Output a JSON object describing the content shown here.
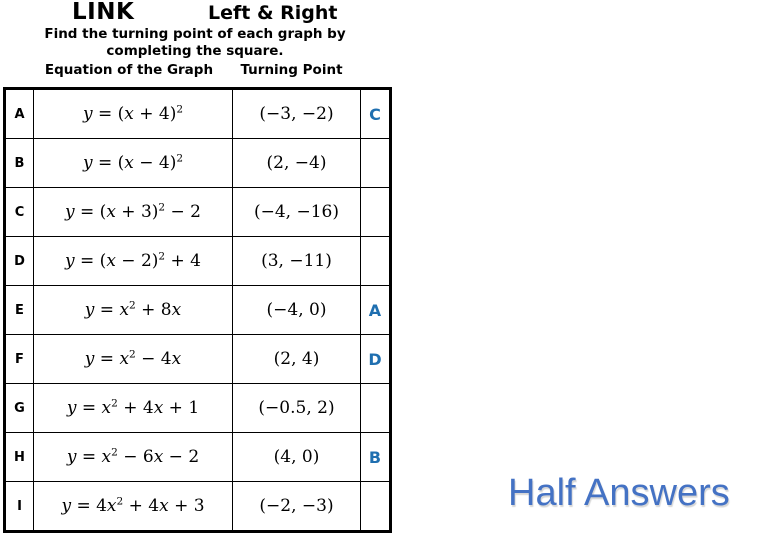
{
  "header": {
    "link_title": "LINK",
    "topic_title": "Left & Right",
    "subtitle": "Find the turning point of each graph by completing the square.",
    "column_headers": {
      "equation": "Equation of the Graph",
      "turning_point": "Turning Point"
    }
  },
  "table": {
    "rows": [
      {
        "label": "A",
        "equation_text": "y = (x + 4)²",
        "equation": {
          "lhs": "y",
          "eq": " = (",
          "var": "x",
          "op": " + 4)",
          "exp": "2",
          "tail": ""
        },
        "turning_point": "(−3, −2)",
        "answer": "C"
      },
      {
        "label": "B",
        "equation_text": "y = (x − 4)²",
        "equation": {
          "lhs": "y",
          "eq": " = (",
          "var": "x",
          "op": " − 4)",
          "exp": "2",
          "tail": ""
        },
        "turning_point": "(2, −4)",
        "answer": ""
      },
      {
        "label": "C",
        "equation_text": "y = (x + 3)² − 2",
        "equation": {
          "lhs": "y",
          "eq": " = (",
          "var": "x",
          "op": " + 3)",
          "exp": "2",
          "tail": " − 2"
        },
        "turning_point": "(−4, −16)",
        "answer": ""
      },
      {
        "label": "D",
        "equation_text": "y = (x − 2)² + 4",
        "equation": {
          "lhs": "y",
          "eq": " = (",
          "var": "x",
          "op": " − 2)",
          "exp": "2",
          "tail": " + 4"
        },
        "turning_point": "(3, −11)",
        "answer": ""
      },
      {
        "label": "E",
        "equation_text": "y = x² + 8x",
        "equation": {
          "lhs": "y",
          "eq": " = ",
          "var": "x",
          "op": "",
          "exp": "2",
          "tail": " + 8x"
        },
        "turning_point": "(−4, 0)",
        "answer": "A"
      },
      {
        "label": "F",
        "equation_text": "y = x² − 4x",
        "equation": {
          "lhs": "y",
          "eq": " = ",
          "var": "x",
          "op": "",
          "exp": "2",
          "tail": " − 4x"
        },
        "turning_point": "(2, 4)",
        "answer": "D"
      },
      {
        "label": "G",
        "equation_text": "y = x² + 4x + 1",
        "equation": {
          "lhs": "y",
          "eq": " = ",
          "var": "x",
          "op": "",
          "exp": "2",
          "tail": " + 4x + 1"
        },
        "turning_point": "(−0.5, 2)",
        "answer": ""
      },
      {
        "label": "H",
        "equation_text": "y = x² − 6x − 2",
        "equation": {
          "lhs": "y",
          "eq": " = ",
          "var": "x",
          "op": "",
          "exp": "2",
          "tail": " − 6x − 2"
        },
        "turning_point": "(4, 0)",
        "answer": "B"
      },
      {
        "label": "I",
        "equation_text": "y = 4x² + 4x + 3",
        "equation": {
          "lhs": "y",
          "eq": " = 4",
          "var": "x",
          "op": "",
          "exp": "2",
          "tail": " + 4x + 3"
        },
        "turning_point": "(−2, −3)",
        "answer": ""
      }
    ]
  },
  "watermark": {
    "text": "Half Answers"
  },
  "colors": {
    "answer_blue": "#1F6FB0",
    "watermark_blue": "#4472C4",
    "table_border": "#000000",
    "page_background": "#ffffff"
  }
}
